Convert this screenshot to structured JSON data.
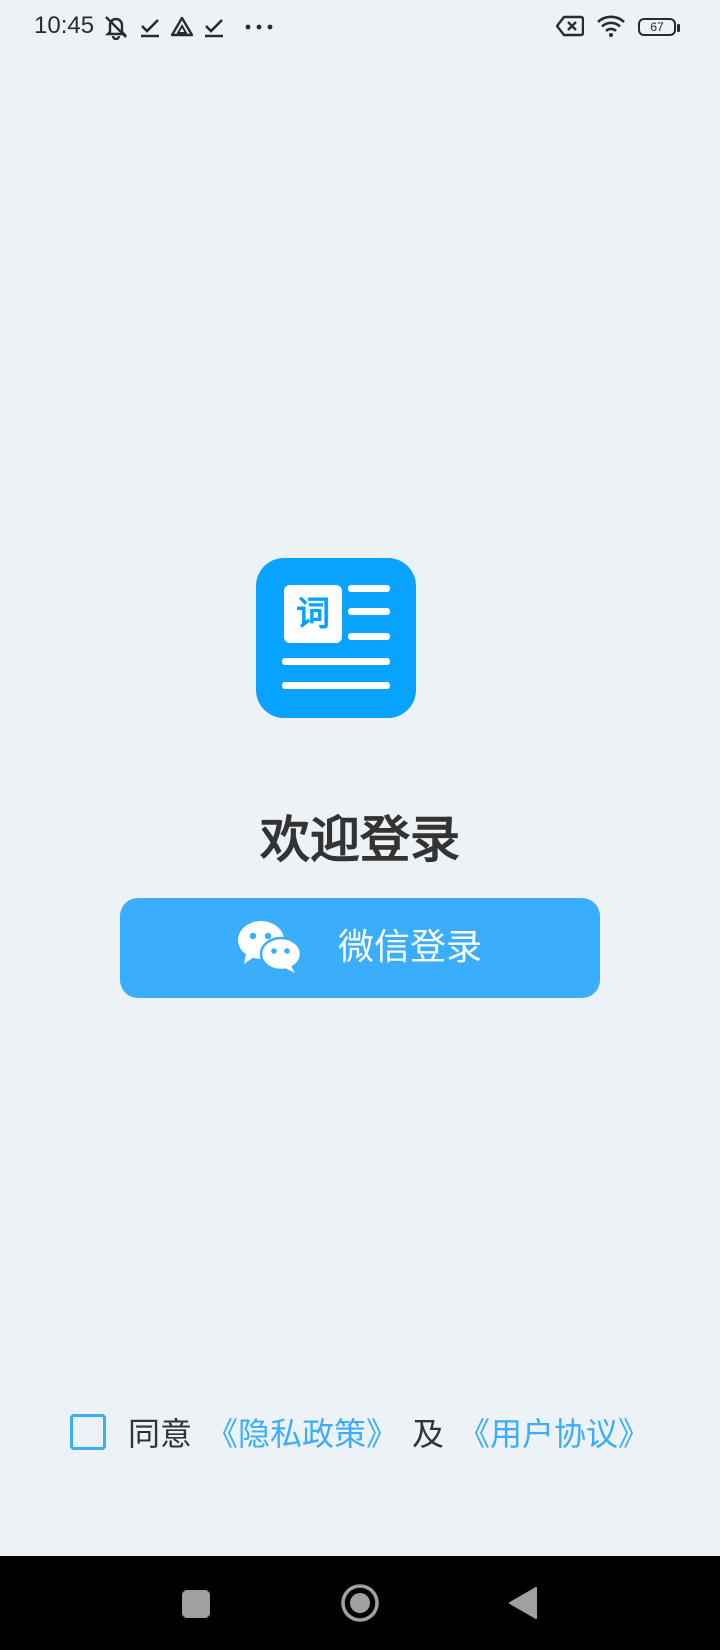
{
  "status_bar": {
    "time": "10:45",
    "battery_level": "67",
    "left_icons": [
      "bell-off-icon",
      "check-icon",
      "drive-icon",
      "check-icon",
      "more-dots-icon"
    ],
    "right_icons": [
      "sim-disabled-icon",
      "wifi-icon",
      "battery-icon"
    ]
  },
  "logo": {
    "char": "词",
    "color": "#08a2ff"
  },
  "title": "欢迎登录",
  "login_button": {
    "label": "微信登录",
    "icon": "wechat-icon",
    "color": "#3aaefc"
  },
  "agreement": {
    "prefix": "同意",
    "privacy_link": "《隐私政策》",
    "connector": "及",
    "terms_link": "《用户协议》",
    "checked": false
  },
  "nav_bar": {
    "icons": [
      "recent-apps-icon",
      "home-icon",
      "back-icon"
    ]
  }
}
